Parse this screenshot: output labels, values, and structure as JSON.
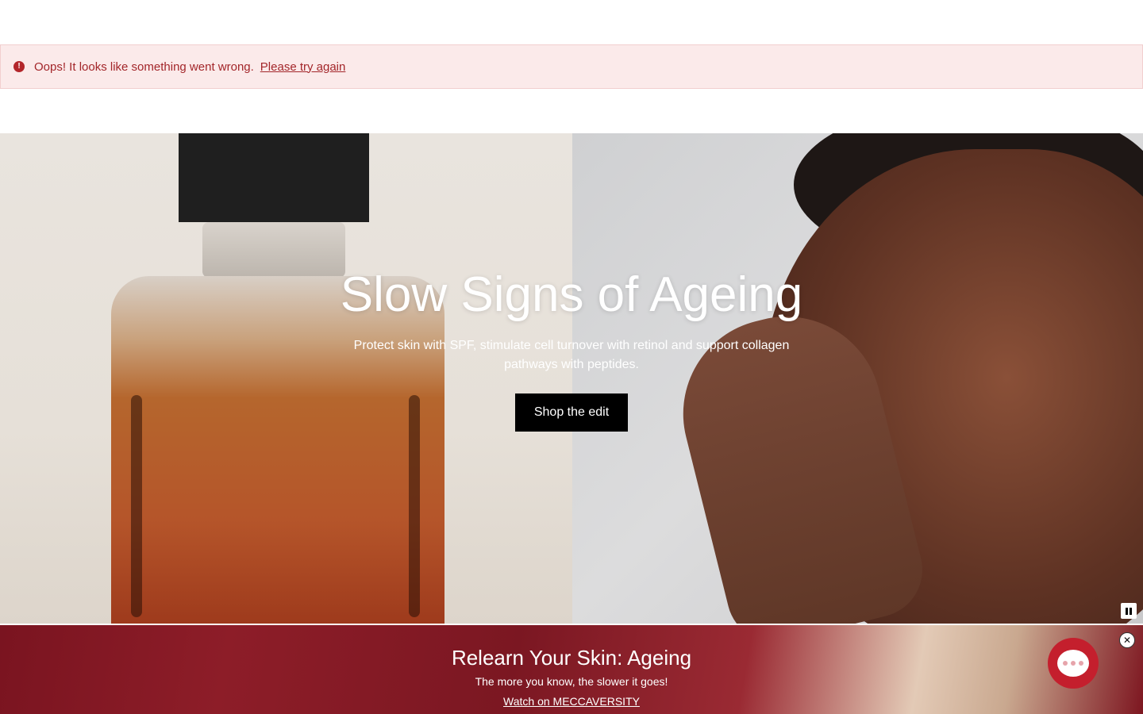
{
  "alert": {
    "icon": "error-icon",
    "icon_glyph": "!",
    "message": "Oops! It looks like something went wrong.",
    "link_label": "Please try again",
    "color": "#a3262a"
  },
  "hero": {
    "title": "Slow Signs of Ageing",
    "subtitle": "Protect skin with SPF, stimulate cell turnover with retinol and support collagen pathways with peptides.",
    "cta_label": "Shop the edit",
    "pause_icon": "pause-icon"
  },
  "promo": {
    "title": "Relearn Your Skin: Ageing",
    "subtitle": "The more you know, the slower it goes!",
    "link_label": "Watch on MECCAVERSITY"
  },
  "chat": {
    "icon": "chat-icon",
    "close_icon": "close-icon",
    "close_glyph": "✕",
    "accent": "#c41f2d"
  }
}
